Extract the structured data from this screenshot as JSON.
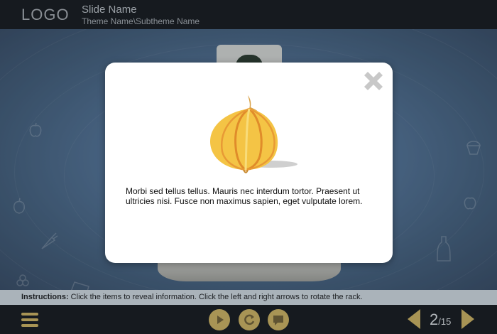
{
  "header": {
    "logo": "LOGO",
    "slide_name": "Slide Name",
    "theme_name": "Theme Name\\Subtheme Name"
  },
  "modal": {
    "text": "Morbi sed tellus tellus. Mauris nec interdum tortor. Praesent ut ultricies nisi. Fusce non maximus sapien, eget vulputate lorem.",
    "image": "onion-image",
    "close_icon": "close-icon"
  },
  "instructions": {
    "label": "Instructions:",
    "text": " Click the items to reveal information. Click the left and right arrows to rotate the rack."
  },
  "footer": {
    "menu_icon": "menu-icon",
    "play_icon": "play-icon",
    "replay_icon": "replay-icon",
    "comment_icon": "comment-icon",
    "current_page": "2",
    "total_pages": "/15"
  },
  "colors": {
    "header_bg": "#161a1f",
    "accent_gold": "#a89455",
    "stage_blue": "#5a7ba0",
    "instructions_bg": "#dde4ea"
  }
}
